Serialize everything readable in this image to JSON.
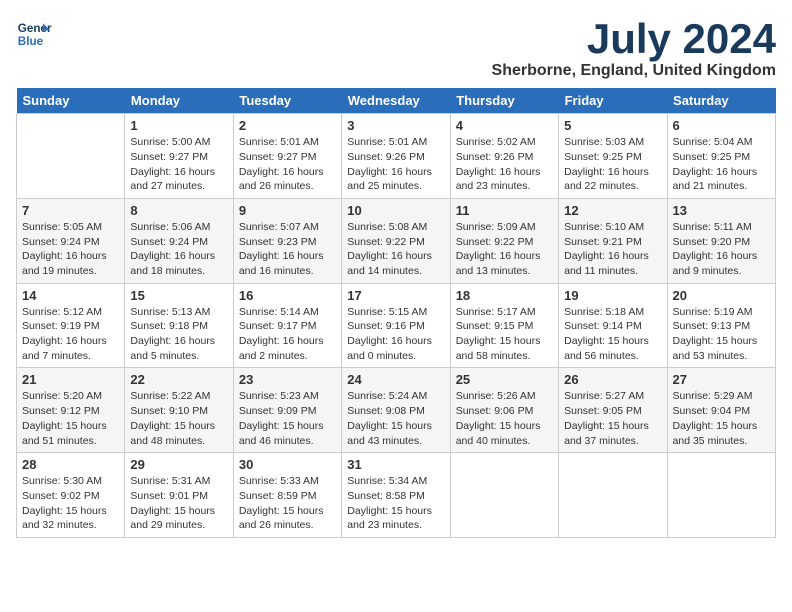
{
  "header": {
    "logo_line1": "General",
    "logo_line2": "Blue",
    "title": "July 2024",
    "subtitle": "Sherborne, England, United Kingdom"
  },
  "weekdays": [
    "Sunday",
    "Monday",
    "Tuesday",
    "Wednesday",
    "Thursday",
    "Friday",
    "Saturday"
  ],
  "weeks": [
    [
      {
        "day": "",
        "sunrise": "",
        "sunset": "",
        "daylight": ""
      },
      {
        "day": "1",
        "sunrise": "Sunrise: 5:00 AM",
        "sunset": "Sunset: 9:27 PM",
        "daylight": "Daylight: 16 hours and 27 minutes."
      },
      {
        "day": "2",
        "sunrise": "Sunrise: 5:01 AM",
        "sunset": "Sunset: 9:27 PM",
        "daylight": "Daylight: 16 hours and 26 minutes."
      },
      {
        "day": "3",
        "sunrise": "Sunrise: 5:01 AM",
        "sunset": "Sunset: 9:26 PM",
        "daylight": "Daylight: 16 hours and 25 minutes."
      },
      {
        "day": "4",
        "sunrise": "Sunrise: 5:02 AM",
        "sunset": "Sunset: 9:26 PM",
        "daylight": "Daylight: 16 hours and 23 minutes."
      },
      {
        "day": "5",
        "sunrise": "Sunrise: 5:03 AM",
        "sunset": "Sunset: 9:25 PM",
        "daylight": "Daylight: 16 hours and 22 minutes."
      },
      {
        "day": "6",
        "sunrise": "Sunrise: 5:04 AM",
        "sunset": "Sunset: 9:25 PM",
        "daylight": "Daylight: 16 hours and 21 minutes."
      }
    ],
    [
      {
        "day": "7",
        "sunrise": "Sunrise: 5:05 AM",
        "sunset": "Sunset: 9:24 PM",
        "daylight": "Daylight: 16 hours and 19 minutes."
      },
      {
        "day": "8",
        "sunrise": "Sunrise: 5:06 AM",
        "sunset": "Sunset: 9:24 PM",
        "daylight": "Daylight: 16 hours and 18 minutes."
      },
      {
        "day": "9",
        "sunrise": "Sunrise: 5:07 AM",
        "sunset": "Sunset: 9:23 PM",
        "daylight": "Daylight: 16 hours and 16 minutes."
      },
      {
        "day": "10",
        "sunrise": "Sunrise: 5:08 AM",
        "sunset": "Sunset: 9:22 PM",
        "daylight": "Daylight: 16 hours and 14 minutes."
      },
      {
        "day": "11",
        "sunrise": "Sunrise: 5:09 AM",
        "sunset": "Sunset: 9:22 PM",
        "daylight": "Daylight: 16 hours and 13 minutes."
      },
      {
        "day": "12",
        "sunrise": "Sunrise: 5:10 AM",
        "sunset": "Sunset: 9:21 PM",
        "daylight": "Daylight: 16 hours and 11 minutes."
      },
      {
        "day": "13",
        "sunrise": "Sunrise: 5:11 AM",
        "sunset": "Sunset: 9:20 PM",
        "daylight": "Daylight: 16 hours and 9 minutes."
      }
    ],
    [
      {
        "day": "14",
        "sunrise": "Sunrise: 5:12 AM",
        "sunset": "Sunset: 9:19 PM",
        "daylight": "Daylight: 16 hours and 7 minutes."
      },
      {
        "day": "15",
        "sunrise": "Sunrise: 5:13 AM",
        "sunset": "Sunset: 9:18 PM",
        "daylight": "Daylight: 16 hours and 5 minutes."
      },
      {
        "day": "16",
        "sunrise": "Sunrise: 5:14 AM",
        "sunset": "Sunset: 9:17 PM",
        "daylight": "Daylight: 16 hours and 2 minutes."
      },
      {
        "day": "17",
        "sunrise": "Sunrise: 5:15 AM",
        "sunset": "Sunset: 9:16 PM",
        "daylight": "Daylight: 16 hours and 0 minutes."
      },
      {
        "day": "18",
        "sunrise": "Sunrise: 5:17 AM",
        "sunset": "Sunset: 9:15 PM",
        "daylight": "Daylight: 15 hours and 58 minutes."
      },
      {
        "day": "19",
        "sunrise": "Sunrise: 5:18 AM",
        "sunset": "Sunset: 9:14 PM",
        "daylight": "Daylight: 15 hours and 56 minutes."
      },
      {
        "day": "20",
        "sunrise": "Sunrise: 5:19 AM",
        "sunset": "Sunset: 9:13 PM",
        "daylight": "Daylight: 15 hours and 53 minutes."
      }
    ],
    [
      {
        "day": "21",
        "sunrise": "Sunrise: 5:20 AM",
        "sunset": "Sunset: 9:12 PM",
        "daylight": "Daylight: 15 hours and 51 minutes."
      },
      {
        "day": "22",
        "sunrise": "Sunrise: 5:22 AM",
        "sunset": "Sunset: 9:10 PM",
        "daylight": "Daylight: 15 hours and 48 minutes."
      },
      {
        "day": "23",
        "sunrise": "Sunrise: 5:23 AM",
        "sunset": "Sunset: 9:09 PM",
        "daylight": "Daylight: 15 hours and 46 minutes."
      },
      {
        "day": "24",
        "sunrise": "Sunrise: 5:24 AM",
        "sunset": "Sunset: 9:08 PM",
        "daylight": "Daylight: 15 hours and 43 minutes."
      },
      {
        "day": "25",
        "sunrise": "Sunrise: 5:26 AM",
        "sunset": "Sunset: 9:06 PM",
        "daylight": "Daylight: 15 hours and 40 minutes."
      },
      {
        "day": "26",
        "sunrise": "Sunrise: 5:27 AM",
        "sunset": "Sunset: 9:05 PM",
        "daylight": "Daylight: 15 hours and 37 minutes."
      },
      {
        "day": "27",
        "sunrise": "Sunrise: 5:29 AM",
        "sunset": "Sunset: 9:04 PM",
        "daylight": "Daylight: 15 hours and 35 minutes."
      }
    ],
    [
      {
        "day": "28",
        "sunrise": "Sunrise: 5:30 AM",
        "sunset": "Sunset: 9:02 PM",
        "daylight": "Daylight: 15 hours and 32 minutes."
      },
      {
        "day": "29",
        "sunrise": "Sunrise: 5:31 AM",
        "sunset": "Sunset: 9:01 PM",
        "daylight": "Daylight: 15 hours and 29 minutes."
      },
      {
        "day": "30",
        "sunrise": "Sunrise: 5:33 AM",
        "sunset": "Sunset: 8:59 PM",
        "daylight": "Daylight: 15 hours and 26 minutes."
      },
      {
        "day": "31",
        "sunrise": "Sunrise: 5:34 AM",
        "sunset": "Sunset: 8:58 PM",
        "daylight": "Daylight: 15 hours and 23 minutes."
      },
      {
        "day": "",
        "sunrise": "",
        "sunset": "",
        "daylight": ""
      },
      {
        "day": "",
        "sunrise": "",
        "sunset": "",
        "daylight": ""
      },
      {
        "day": "",
        "sunrise": "",
        "sunset": "",
        "daylight": ""
      }
    ]
  ]
}
